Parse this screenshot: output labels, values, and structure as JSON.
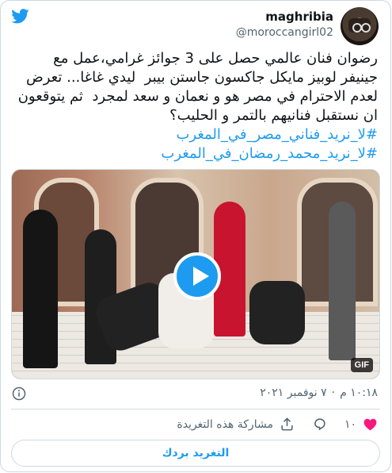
{
  "user": {
    "name": "maghribia",
    "handle": "@moroccangirl02"
  },
  "tweet": {
    "text": "رضوان فنان عالمي حصل على 3 جوائز غرامي،عمل مع جينيفر لوبيز مايكل جاكسون جاستن بيبر  ليدي غاغا... تعرض لعدم الاحترام في مصر هو و نعمان و سعد لمجرد  ثم يتوقعون ان نستقبل فنانيهم بالتمر و الحليب؟",
    "hashtags": [
      "#لا_نريد_فناني_مصر_في_المغرب",
      "#لا_نريد_محمد_رمضان_في_المغرب"
    ]
  },
  "media": {
    "badge": "GIF"
  },
  "meta": {
    "time": "١٠:١٨ م",
    "separator": "·",
    "date": "٧ نوفمبر ٢٠٢١"
  },
  "actions": {
    "likes_count": "١٠",
    "share_label": "مشاركة هذه التغريدة"
  },
  "reply_button_label": "التغريد بردك",
  "colors": {
    "accent": "#1d9bf0",
    "like": "#f91880",
    "secondary_text": "#536471",
    "border": "#cfd9de"
  },
  "icons": [
    "twitter-logo-icon",
    "heart-icon",
    "reply-icon",
    "share-icon",
    "info-icon",
    "play-icon"
  ]
}
